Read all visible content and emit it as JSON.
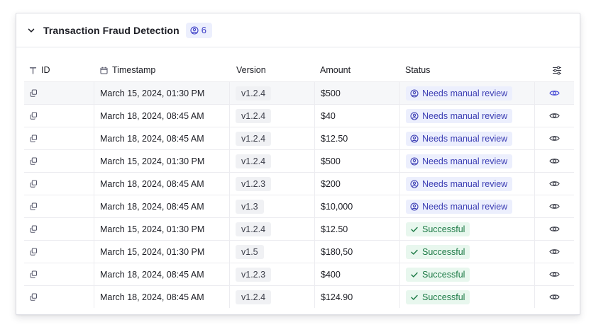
{
  "panel": {
    "title": "Transaction Fraud Detection",
    "count": "6"
  },
  "columns": {
    "id": "ID",
    "timestamp": "Timestamp",
    "version": "Version",
    "amount": "Amount",
    "status": "Status"
  },
  "rows": [
    {
      "timestamp": "March 15, 2024, 01:30 PM",
      "version": "v1.2.4",
      "amount": "$500",
      "status": "Needs manual review",
      "status_kind": "review"
    },
    {
      "timestamp": "March 18, 2024, 08:45 AM",
      "version": "v1.2.4",
      "amount": "$40",
      "status": "Needs manual review",
      "status_kind": "review"
    },
    {
      "timestamp": "March 18, 2024, 08:45 AM",
      "version": "v1.2.4",
      "amount": "$12.50",
      "status": "Needs manual review",
      "status_kind": "review"
    },
    {
      "timestamp": "March 15, 2024, 01:30 PM",
      "version": "v1.2.4",
      "amount": "$500",
      "status": "Needs manual review",
      "status_kind": "review"
    },
    {
      "timestamp": "March 18, 2024, 08:45 AM",
      "version": "v1.2.3",
      "amount": "$200",
      "status": "Needs manual review",
      "status_kind": "review"
    },
    {
      "timestamp": "March 18, 2024, 08:45 AM",
      "version": "v1.3",
      "amount": "$10,000",
      "status": "Needs manual review",
      "status_kind": "review"
    },
    {
      "timestamp": "March 15, 2024, 01:30 PM",
      "version": "v1.2.4",
      "amount": "$12.50",
      "status": "Successful",
      "status_kind": "success"
    },
    {
      "timestamp": "March 15, 2024, 01:30 PM",
      "version": "v1.5",
      "amount": "$180,50",
      "status": "Successful",
      "status_kind": "success"
    },
    {
      "timestamp": "March 18, 2024, 08:45 AM",
      "version": "v1.2.3",
      "amount": "$400",
      "status": "Successful",
      "status_kind": "success"
    },
    {
      "timestamp": "March 18, 2024, 08:45 AM",
      "version": "v1.2.4",
      "amount": "$124.90",
      "status": "Successful",
      "status_kind": "success"
    }
  ],
  "icons": {
    "collapse": "chevron-down-icon",
    "count": "user-circle-icon",
    "id_column": "text-type-icon",
    "timestamp_column": "calendar-icon",
    "column_settings": "sliders-icon",
    "row_copy": "copy-icon",
    "row_view": "eye-icon",
    "review_status": "user-circle-icon",
    "success_status": "check-icon"
  },
  "colors": {
    "accent": "#3d3fb4",
    "review_bg": "#eceffd",
    "success_text": "#1c7a45",
    "success_bg": "#e8f7ee",
    "eye_active": "#4a4dd6",
    "eye_default": "#3d3f4a"
  }
}
